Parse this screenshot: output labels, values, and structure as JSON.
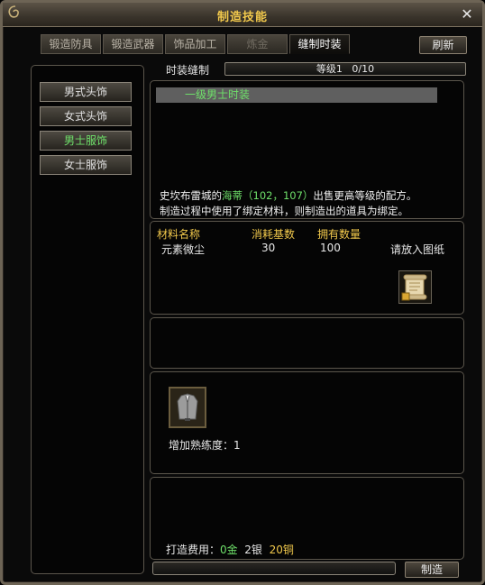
{
  "window": {
    "title": "制造技能"
  },
  "tabs": [
    {
      "label": "锻造防具",
      "state": "inactive"
    },
    {
      "label": "锻造武器",
      "state": "inactive"
    },
    {
      "label": "饰品加工",
      "state": "inactive"
    },
    {
      "label": "炼金",
      "state": "disabled"
    },
    {
      "label": "缝制时装",
      "state": "active"
    }
  ],
  "toolbar": {
    "refresh_label": "刷新"
  },
  "categories": [
    {
      "label": "男式头饰",
      "selected": false
    },
    {
      "label": "女式头饰",
      "selected": false
    },
    {
      "label": "男士服饰",
      "selected": true
    },
    {
      "label": "女士服饰",
      "selected": false
    }
  ],
  "skill": {
    "name": "时装缝制",
    "level_text": "等级1",
    "progress_text": "0/10",
    "progress_fraction": 0
  },
  "recipes": [
    {
      "label": "一级男士时装",
      "selected": true
    }
  ],
  "description": {
    "part1": "史坎布雷城的",
    "npc": "海蒂（102，107）",
    "part2": "出售更高等级的配方。",
    "line2": "制造过程中使用了绑定材料，则制造出的道具为绑定。"
  },
  "materials": {
    "headers": {
      "name": "材料名称",
      "cost": "消耗基数",
      "owned": "拥有数量"
    },
    "rows": [
      {
        "name": "元素微尘",
        "cost": "30",
        "owned": "100"
      }
    ],
    "scroll_hint": "请放入图纸"
  },
  "result": {
    "proficiency_text": "增加熟练度：1"
  },
  "cost": {
    "label": "打造费用：",
    "gold": "0金",
    "silver": "2银",
    "copper": "20铜"
  },
  "craft": {
    "button_label": "制造",
    "progress_fraction": 0
  },
  "icons": {
    "scroll_slot": "blueprint-scroll-icon",
    "item_slot": "suit-armor-icon",
    "close": "close-icon",
    "ornament": "window-ornament-icon"
  },
  "colors": {
    "title": "#f2c94c",
    "highlight_green": "#6fe06a",
    "header_gold": "#f2c94c"
  }
}
